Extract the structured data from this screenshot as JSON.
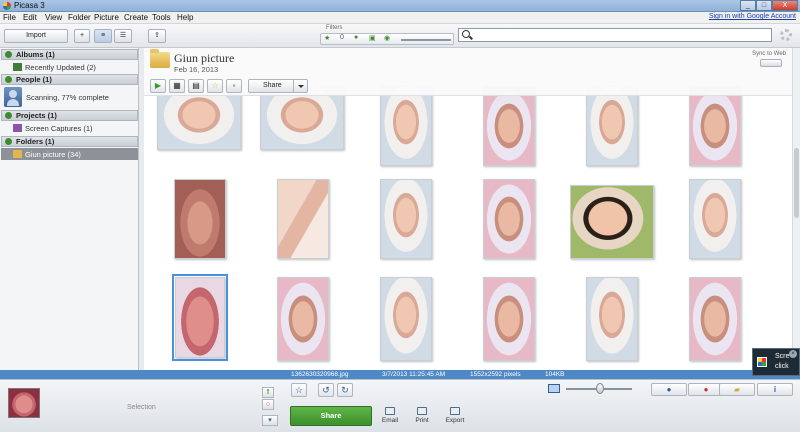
{
  "window": {
    "title": "Picasa 3",
    "controls": [
      "_",
      "□",
      "X"
    ]
  },
  "menu": {
    "items": [
      "File",
      "Edit",
      "View",
      "Folder",
      "Picture",
      "Create",
      "Tools",
      "Help"
    ],
    "signin": "Sign in with Google Account"
  },
  "toolbar": {
    "import_label": "Import",
    "filters_label": "Filters",
    "filter_count": "0",
    "search_placeholder": ""
  },
  "sidebar": {
    "albums": {
      "header": "Albums (1)",
      "items": [
        "Recently Updated (2)"
      ]
    },
    "people": {
      "header": "People (1)",
      "status": "Scanning, 77% complete"
    },
    "projects": {
      "header": "Projects (1)",
      "items": [
        "Screen Captures (1)"
      ]
    },
    "folders": {
      "header": "Folders (1)",
      "items": [
        "Giun picture (34)"
      ]
    }
  },
  "folder": {
    "title": "Giun picture",
    "date": "Feb 16, 2013",
    "sync_label": "Sync to Web",
    "share_label": "Share"
  },
  "status": {
    "filename": "1362630320968.jpg",
    "datetime": "3/7/2013 11:25:45 AM",
    "dimensions": "1552x2592 pixels",
    "size": "104KB"
  },
  "notification": {
    "line1": "Scre",
    "line2": "click"
  },
  "tray": {
    "selection_label": "Selection",
    "share_label": "Share",
    "email_label": "Email",
    "print_label": "Print",
    "export_label": "Export"
  },
  "colors": {
    "status_bar": "#4f88c7",
    "share_green": "#4ca33a",
    "accent_green": "#3f8a2e"
  }
}
